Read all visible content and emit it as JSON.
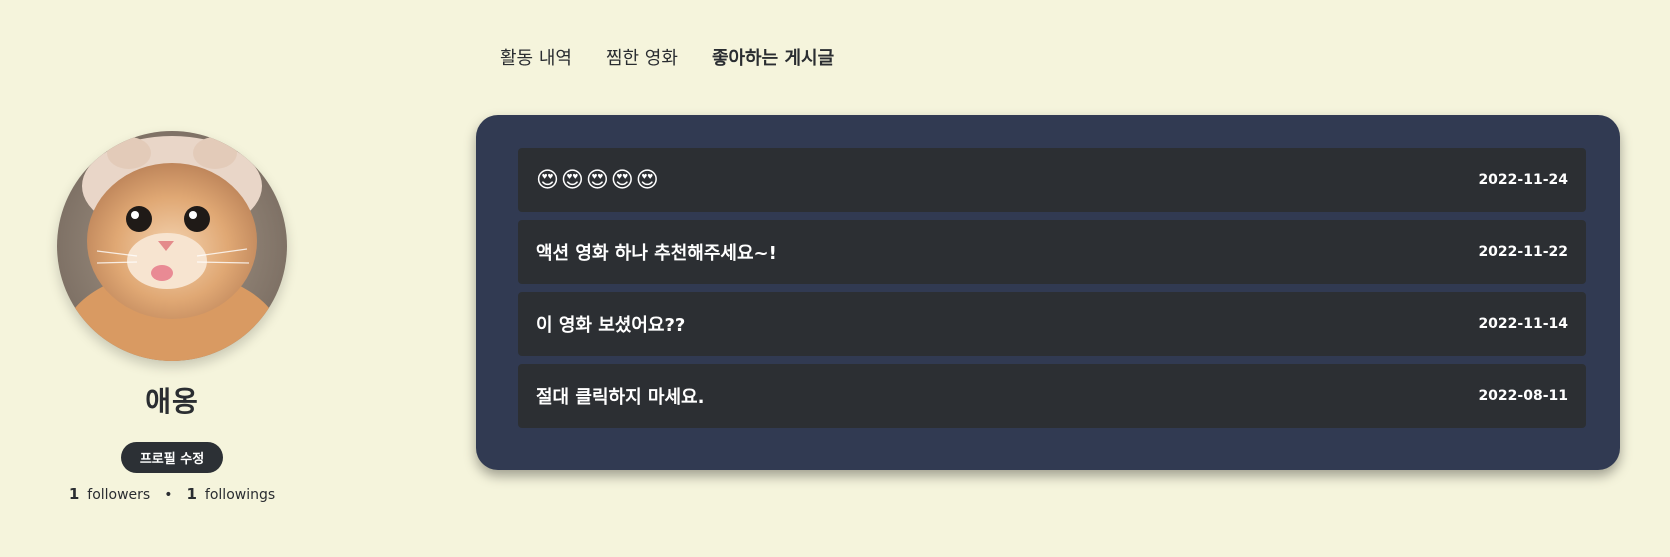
{
  "profile": {
    "username": "애옹",
    "edit_label": "프로필 수정",
    "followers_count": "1",
    "followers_label": "followers",
    "separator": "•",
    "followings_count": "1",
    "followings_label": "followings"
  },
  "tabs": [
    {
      "label": "활동 내역",
      "active": false
    },
    {
      "label": "찜한 영화",
      "active": false
    },
    {
      "label": "좋아하는 게시글",
      "active": true
    }
  ],
  "posts": [
    {
      "title": "😍😍😍😍😍",
      "date": "2022-11-24"
    },
    {
      "title": "액션 영화 하나 추천해주세요~!",
      "date": "2022-11-22"
    },
    {
      "title": "이 영화 보셨어요??",
      "date": "2022-11-14"
    },
    {
      "title": "절대 클릭하지 마세요.",
      "date": "2022-08-11"
    }
  ],
  "colors": {
    "background": "#f5f4dc",
    "panel": "#313a52",
    "post_row": "#2c2f33",
    "button": "#2c3035",
    "text_dark": "#2a2d31"
  }
}
